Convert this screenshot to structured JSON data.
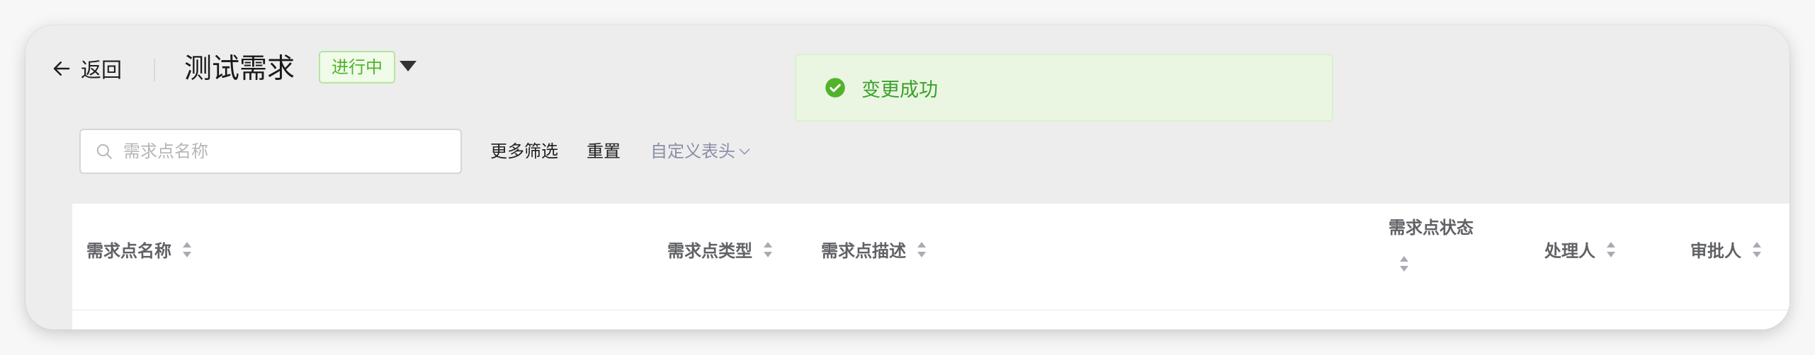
{
  "header": {
    "back_label": "返回",
    "title": "测试需求",
    "status_tag": "进行中"
  },
  "toast": {
    "message": "变更成功",
    "color": "#52b32a"
  },
  "filters": {
    "search_placeholder": "需求点名称",
    "more_filters": "更多筛选",
    "reset": "重置",
    "custom_header": "自定义表头"
  },
  "table": {
    "columns": [
      {
        "label": "需求点名称"
      },
      {
        "label": "需求点类型"
      },
      {
        "label": "需求点描述"
      },
      {
        "label": "需求点状态"
      },
      {
        "label": "处理人"
      },
      {
        "label": "审批人"
      }
    ]
  }
}
